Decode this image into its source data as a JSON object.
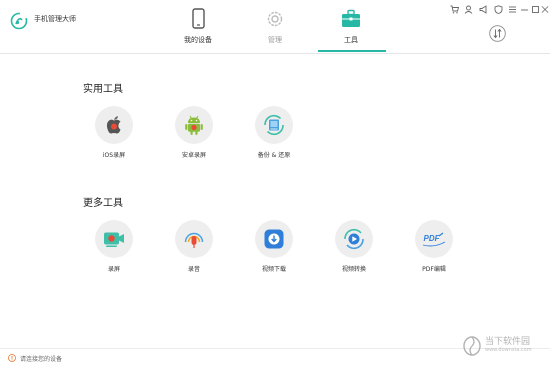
{
  "app": {
    "title": "手机管理大师"
  },
  "tabs": [
    {
      "label": "我的设备",
      "icon": "phone-icon",
      "state": "normal"
    },
    {
      "label": "管理",
      "icon": "gear-icon",
      "state": "disabled"
    },
    {
      "label": "工具",
      "icon": "toolbox-icon",
      "state": "active"
    }
  ],
  "window_controls": [
    "cart-icon",
    "user-icon",
    "megaphone-icon",
    "shield-icon",
    "menu-icon",
    "minimize-icon",
    "maximize-icon",
    "close-icon"
  ],
  "sections": {
    "practical": {
      "title": "实用工具",
      "tools": [
        {
          "label": "iOS录屏",
          "icon": "apple-record-icon"
        },
        {
          "label": "安卓录屏",
          "icon": "android-record-icon"
        },
        {
          "label": "备份 & 还原",
          "icon": "backup-restore-icon"
        }
      ]
    },
    "more": {
      "title": "更多工具",
      "tools": [
        {
          "label": "录屏",
          "icon": "screen-record-icon"
        },
        {
          "label": "录音",
          "icon": "audio-record-icon"
        },
        {
          "label": "视频下载",
          "icon": "video-download-icon"
        },
        {
          "label": "视频转换",
          "icon": "video-convert-icon"
        },
        {
          "label": "PDF编辑",
          "icon": "pdf-edit-icon"
        }
      ]
    }
  },
  "footer": {
    "status": "请连接您的设备"
  },
  "watermark": {
    "name": "当下软件园",
    "url": "www.downxia.com"
  },
  "colors": {
    "accent": "#27b8a5",
    "icon_bg": "#eeeeee"
  }
}
